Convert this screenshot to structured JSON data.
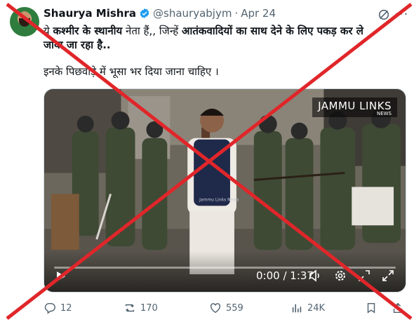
{
  "tweet": {
    "author_name": "Shaurya Mishra",
    "handle": "@shauryabjym",
    "separator": "·",
    "date": "Apr 24",
    "text_line1_parts": [
      {
        "t": "ये ",
        "bold": false
      },
      {
        "t": "कश्मीर के स्थानीय",
        "bold": true
      },
      {
        "t": " नेता हैं,, जिन्हें ",
        "bold": false
      },
      {
        "t": "आतंकवादियों का साथ देने के लिए पकड़ कर ले",
        "bold": true
      }
    ],
    "text_line2_parts": [
      {
        "t": "जाया जा रहा है..",
        "bold": true
      }
    ],
    "text_line3": "इनके पिछवाड़े में भूसा भर दिया जाना चाहिए ।"
  },
  "video": {
    "watermark": "JAMMU LINKS",
    "watermark_sub": "NEWS",
    "vest_text": "Jammu Links News",
    "time_current": "0:00",
    "time_sep": " / ",
    "time_total": "1:37",
    "progress_fraction": 0.0
  },
  "actions": {
    "replies": "12",
    "reposts": "170",
    "likes": "559",
    "views": "24K"
  },
  "icons": {
    "verified": "verified-badge-icon",
    "grok": "grok-icon",
    "more": "more-icon",
    "play": "play-icon",
    "volume": "volume-icon",
    "settings": "gear-icon",
    "minimize": "minimize-icon",
    "fullscreen": "fullscreen-icon",
    "reply": "reply-icon",
    "repost": "repost-icon",
    "like": "heart-icon",
    "views": "views-icon",
    "share": "share-icon"
  },
  "colors": {
    "verified": "#1d9bf0",
    "muted": "#536471",
    "strike": "#e0262a"
  }
}
